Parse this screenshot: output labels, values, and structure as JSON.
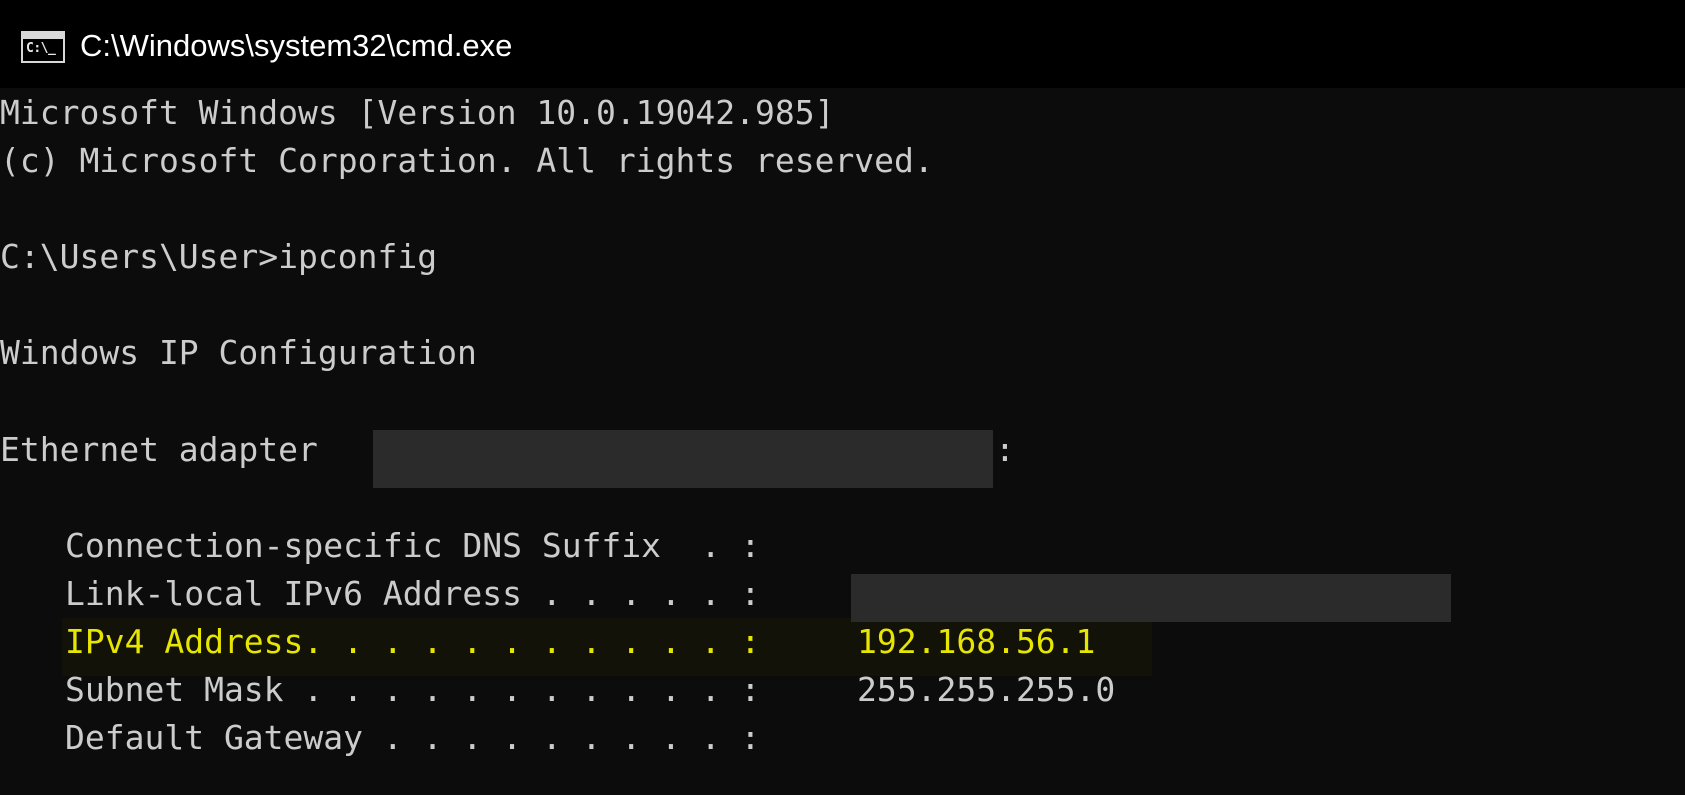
{
  "window": {
    "title": "C:\\Windows\\system32\\cmd.exe",
    "icon": "console-icon",
    "icon_glyph": "C:\\_"
  },
  "console": {
    "lines": [
      "Microsoft Windows [Version 10.0.19042.985]",
      "(c) Microsoft Corporation. All rights reserved.",
      "C:\\Users\\User>ipconfig",
      "Windows IP Configuration",
      "Ethernet adapter",
      ":"
    ],
    "adapter": {
      "dns_suffix": "Connection-specific DNS Suffix  . :",
      "ipv6": "Link-local IPv6 Address . . . . . :",
      "ipv4_label": "IPv4 Address. . . . . . . . . . . :",
      "ipv4_value": "192.168.56.1",
      "subnet_label": "Subnet Mask . . . . . . . . . . . :",
      "subnet_value": "255.255.255.0",
      "gateway": "Default Gateway . . . . . . . . . :"
    }
  },
  "colors": {
    "background": "#0c0c0c",
    "text": "#cccccc",
    "highlight": "#e6e600",
    "redaction": "#2b2b2b"
  }
}
